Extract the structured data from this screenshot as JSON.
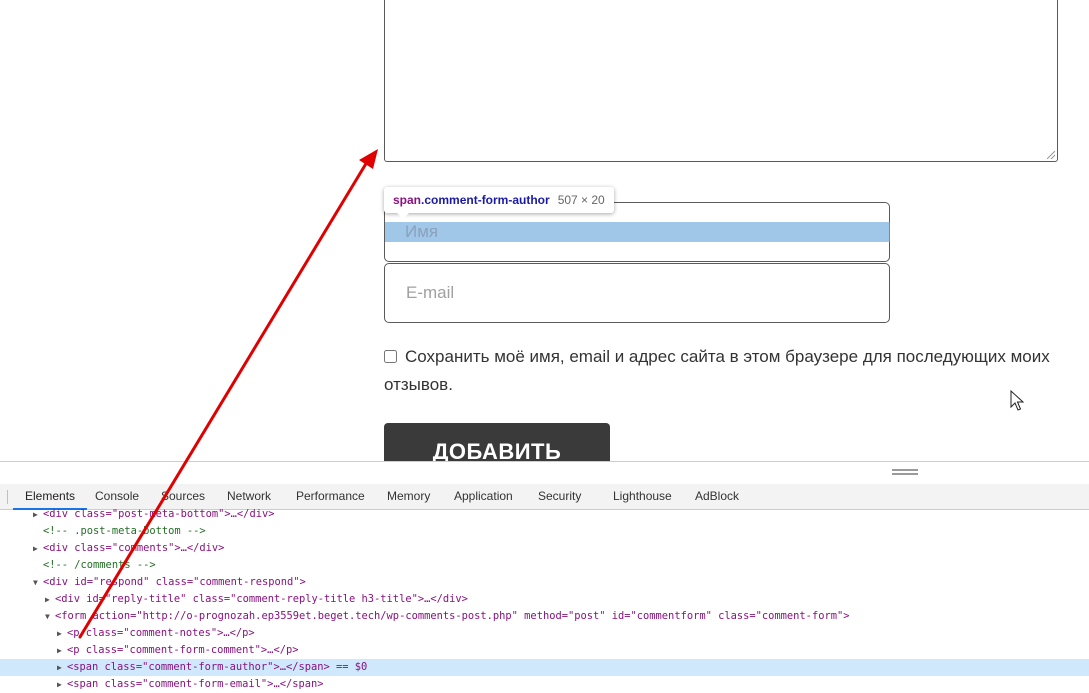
{
  "form": {
    "author_placeholder": "Имя",
    "email_placeholder": "E-mail",
    "consent_text": "Сохранить моё имя, email и адрес сайта в этом браузере для последующих моих отзывов.",
    "submit_label": "ДОБАВИТЬ"
  },
  "tooltip": {
    "tag": "span",
    "cls": ".comment-form-author",
    "size": "507 × 20"
  },
  "devtools": {
    "tabs": [
      "Elements",
      "Console",
      "Sources",
      "Network",
      "Performance",
      "Memory",
      "Application",
      "Security",
      "Lighthouse",
      "AdBlock"
    ],
    "active_tab": "Elements",
    "tree": [
      "<div class=\"post-meta-bottom\">…</div>",
      "<!-- .post-meta-bottom -->",
      "<div class=\"comments\">…</div>",
      "<!-- /comments -->",
      "<div id=\"respond\" class=\"comment-respond\">",
      "<div id=\"reply-title\" class=\"comment-reply-title h3-title\">…</div>",
      "<form action=\"http://o-prognozah.ep3559et.beget.tech/wp-comments-post.php\" method=\"post\" id=\"commentform\" class=\"comment-form\">",
      "<p class=\"comment-notes\">…</p>",
      "<p class=\"comment-form-comment\">…</p>",
      "<span class=\"comment-form-author\">…</span> == $0",
      "<span class=\"comment-form-email\">…</span>"
    ]
  },
  "colors": {
    "highlight": "#6fa8dc",
    "arrow": "#e00000",
    "submit_bg": "#3a3a3a",
    "selected_row": "#cfe8fc"
  }
}
